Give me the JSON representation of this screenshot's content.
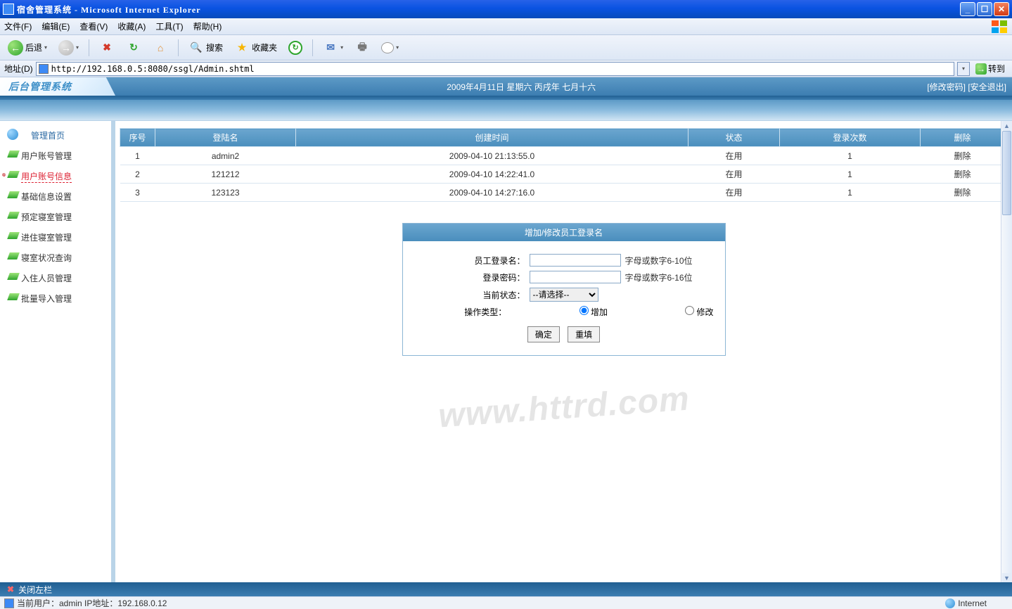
{
  "window": {
    "title": "宿舍管理系统 - Microsoft Internet Explorer"
  },
  "menubar": {
    "items": [
      "文件(F)",
      "编辑(E)",
      "查看(V)",
      "收藏(A)",
      "工具(T)",
      "帮助(H)"
    ]
  },
  "toolbar": {
    "back": "后退",
    "search": "搜索",
    "favorites": "收藏夹"
  },
  "addressbar": {
    "label": "地址(D)",
    "url": "http://192.168.0.5:8080/ssgl/Admin.shtml",
    "go": "转到"
  },
  "app_header": {
    "logo": "后台管理系统",
    "date": "2009年4月11日  星期六  丙戌年  七月十六",
    "link_pwd": "[修改密码]",
    "link_logout": "[安全退出]"
  },
  "sidebar": {
    "home": "管理首页",
    "items": [
      "用户账号管理",
      "用户账号信息",
      "基础信息设置",
      "预定寝室管理",
      "进住寝室管理",
      "寝室状况查询",
      "入住人员管理",
      "批量导入管理"
    ],
    "active_index": 1
  },
  "table": {
    "headers": {
      "idx": "序号",
      "login": "登陆名",
      "created": "创建时间",
      "state": "状态",
      "count": "登录次数",
      "del": "删除"
    },
    "rows": [
      {
        "idx": "1",
        "login": "admin2",
        "created": "2009-04-10 21:13:55.0",
        "state": "在用",
        "count": "1",
        "del": "删除"
      },
      {
        "idx": "2",
        "login": "121212",
        "created": "2009-04-10 14:22:41.0",
        "state": "在用",
        "count": "1",
        "del": "删除"
      },
      {
        "idx": "3",
        "login": "123123",
        "created": "2009-04-10 14:27:16.0",
        "state": "在用",
        "count": "1",
        "del": "删除"
      }
    ]
  },
  "form": {
    "title": "增加/修改员工登录名",
    "login_label": "员工登录名：",
    "login_hint": "字母或数字6-10位",
    "pwd_label": "登录密码：",
    "pwd_hint": "字母或数字6-16位",
    "state_label": "当前状态：",
    "state_value": "--请选择--",
    "optype_label": "操作类型：",
    "opt_add": "增加",
    "opt_mod": "修改",
    "btn_ok": "确定",
    "btn_reset": "重填"
  },
  "close_strip": {
    "label": "关闭左栏"
  },
  "statusbar": {
    "left": "当前用户：admin  IP地址：192.168.0.12",
    "right": "Internet"
  },
  "watermark": "www.httrd.com"
}
